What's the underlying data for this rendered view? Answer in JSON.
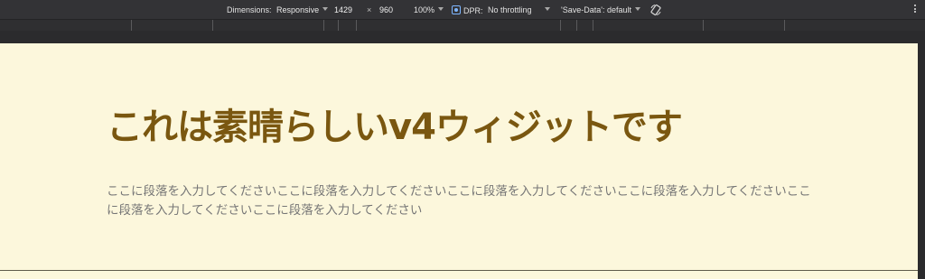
{
  "toolbar": {
    "dimensions_label": "Dimensions:",
    "dimensions_value": "Responsive",
    "width": "1429",
    "times": "×",
    "height": "960",
    "zoom": "100%",
    "dpr_label": "DPR:",
    "throttling": "No throttling",
    "save_data": "'Save-Data': default"
  },
  "page": {
    "heading": "これは素晴らしいv4ウィジットです",
    "paragraph": "ここに段落を入力してくださいここに段落を入力してくださいここに段落を入力してくださいここに段落を入力してくださいここに段落を入力してくださいここに段落を入力してください"
  },
  "colors": {
    "heading": "#7a5710",
    "background": "#fcf7dc",
    "paragraph": "#767676"
  }
}
